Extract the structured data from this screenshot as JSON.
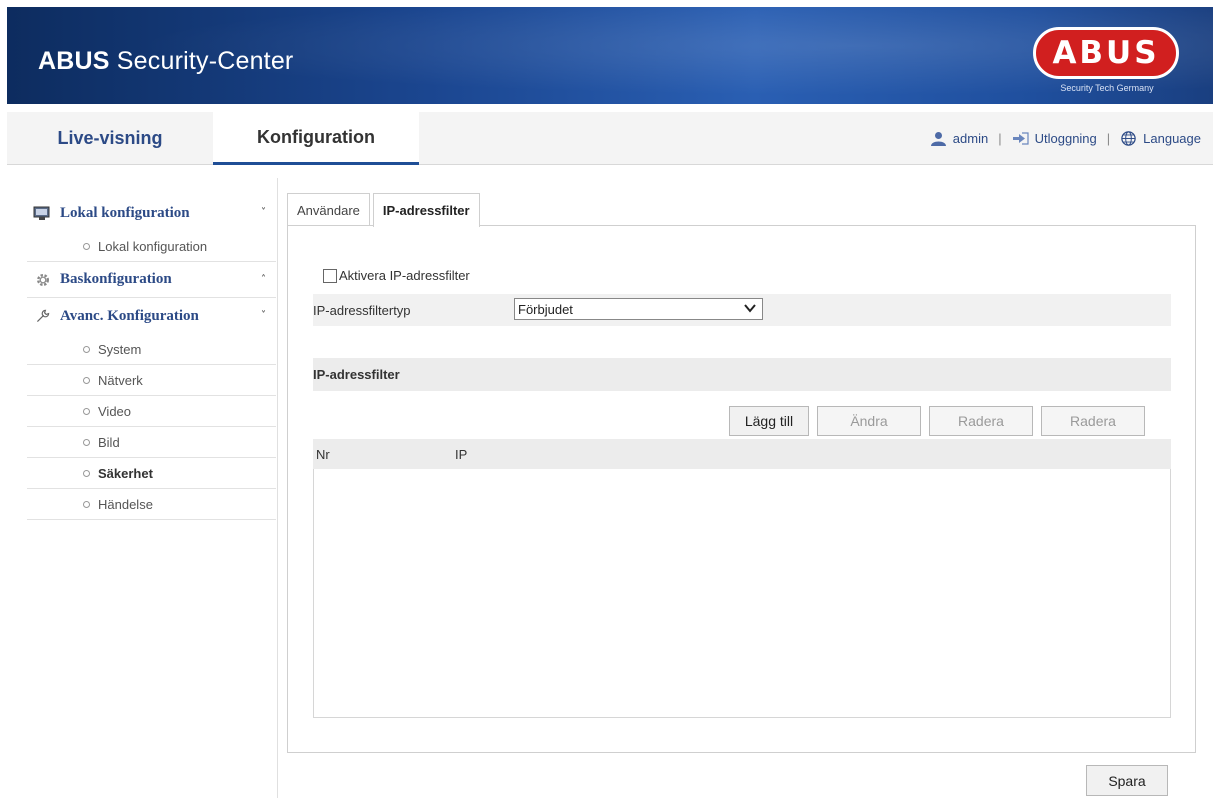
{
  "header": {
    "app_title_bold": "ABUS",
    "app_title_rest": " Security-Center",
    "logo_text": "ABUS",
    "logo_tagline": "Security Tech Germany",
    "banner_color": "#1b4690",
    "logo_color": "#d11f1f"
  },
  "topnav": {
    "tabs": [
      {
        "label": "Live-visning",
        "active": false
      },
      {
        "label": "Konfiguration",
        "active": true
      }
    ],
    "user": "admin",
    "logout": "Utloggning",
    "language": "Language",
    "separator": "|"
  },
  "sidebar": {
    "groups": [
      {
        "label": "Lokal konfiguration",
        "icon": "monitor-icon",
        "chevron": "˅",
        "items": [
          {
            "label": "Lokal konfiguration",
            "active": false
          }
        ]
      },
      {
        "label": "Baskonfiguration",
        "icon": "gear-icon",
        "chevron": "˄",
        "items": []
      },
      {
        "label": "Avanc. Konfiguration",
        "icon": "wrench-icon",
        "chevron": "˅",
        "items": [
          {
            "label": "System",
            "active": false
          },
          {
            "label": "Nätverk",
            "active": false
          },
          {
            "label": "Video",
            "active": false
          },
          {
            "label": "Bild",
            "active": false
          },
          {
            "label": "Säkerhet",
            "active": true
          },
          {
            "label": "Händelse",
            "active": false
          }
        ]
      }
    ]
  },
  "content": {
    "tabs": [
      {
        "label": "Användare",
        "active": false
      },
      {
        "label": "IP-adressfilter",
        "active": true
      }
    ],
    "enable_checkbox_label": "Aktivera IP-adressfilter",
    "enable_checked": false,
    "filter_type_label": "IP-adressfiltertyp",
    "filter_type_value": "Förbjudet",
    "section_title": "IP-adressfilter",
    "buttons": {
      "add": "Lägg till",
      "edit": "Ändra",
      "delete": "Radera",
      "delete_all": "Radera"
    },
    "table": {
      "columns": [
        "Nr",
        "IP"
      ],
      "rows": []
    },
    "save": "Spara"
  }
}
